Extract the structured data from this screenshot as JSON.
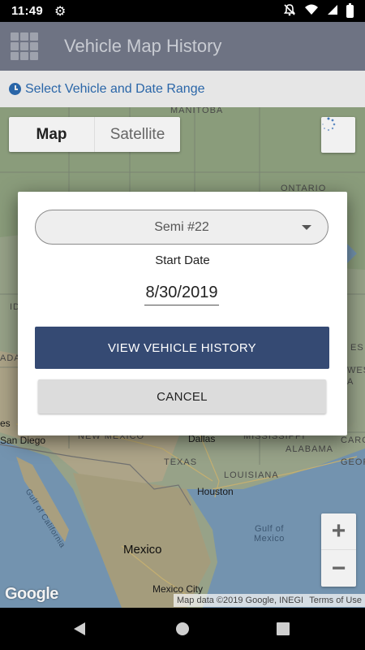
{
  "status_bar": {
    "time": "11:49",
    "icons": [
      "gear-icon",
      "notifications-off-icon",
      "wifi-icon",
      "signal-icon",
      "battery-charging-icon"
    ]
  },
  "app_bar": {
    "title": "Vehicle Map History",
    "menu_icon": "apps-grid-icon"
  },
  "sub_bar": {
    "text": "Select Vehicle and Date Range",
    "icon": "clock-icon"
  },
  "map": {
    "type_toggle": {
      "map_label": "Map",
      "satellite_label": "Satellite",
      "selected": "Map"
    },
    "labels": {
      "manitoba": "MANITOBA",
      "ontario": "ONTARIO",
      "new_mexico": "NEW MEXICO",
      "texas": "TEXAS",
      "mississippi": "MISSISSIPPI",
      "alabama": "ALABAMA",
      "louisiana": "LOUISIANA",
      "georgia": "GEORGIA",
      "dallas": "Dallas",
      "houston": "Houston",
      "san_diego": "San Diego",
      "mexico": "Mexico",
      "mexico_city": "Mexico City",
      "gulf_of_california": "Gulf of California",
      "gulf_of_mexico": "Gulf of\nMexico",
      "edge_left_1": "ID",
      "edge_left_2": "ADA",
      "edge_left_3": "es",
      "edge_right_1": "ES",
      "edge_right_2": "WES",
      "edge_right_3": "CARO",
      "edge_right_4": "A"
    },
    "attribution": "Map data ©2019 Google, INEGI",
    "terms": "Terms of Use",
    "logo": "Google"
  },
  "dialog": {
    "vehicle_selected": "Semi #22",
    "start_date_label": "Start Date",
    "start_date_value": "8/30/2019",
    "view_button": "VIEW VEHICLE HISTORY",
    "cancel_button": "CANCEL"
  },
  "colors": {
    "app_bar": "#6e7383",
    "accent_blue": "#2a66a8",
    "primary_button": "#354a73"
  }
}
